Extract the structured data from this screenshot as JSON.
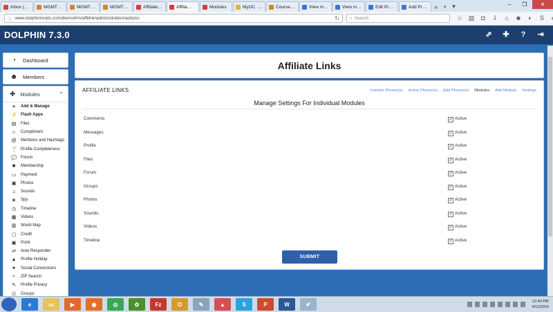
{
  "browser": {
    "tabs": [
      {
        "label": "Inbox (75…",
        "icon_color": "#d44638",
        "active": false
      },
      {
        "label": "MGMT20…",
        "icon_color": "#c98a2a",
        "active": false
      },
      {
        "label": "MGMT20…",
        "icon_color": "#c98a2a",
        "active": false
      },
      {
        "label": "MGMT20…",
        "icon_color": "#c98a2a",
        "active": false
      },
      {
        "label": "Affiliate L…",
        "icon_color": "#d43c3c",
        "active": false
      },
      {
        "label": "Affilia…",
        "icon_color": "#d43c3c",
        "active": true
      },
      {
        "label": "Modules",
        "icon_color": "#d43c3c",
        "active": false
      },
      {
        "label": "MyOC · D…",
        "icon_color": "#e2b33b",
        "active": false
      },
      {
        "label": "Course …",
        "icon_color": "#c98a2a",
        "active": false
      },
      {
        "label": "View mes…",
        "icon_color": "#3a79c9",
        "active": false
      },
      {
        "label": "View mes…",
        "icon_color": "#3a79c9",
        "active": false
      },
      {
        "label": "Edit Prod…",
        "icon_color": "#3a79c9",
        "active": false
      },
      {
        "label": "Add Prod…",
        "icon_color": "#3a79c9",
        "active": false
      }
    ],
    "url": "www.dolphinmods.com/demo4/m/affilink/administration/actions",
    "search_placeholder": "Search"
  },
  "app": {
    "logo": "DOLPHIN 7.3.0"
  },
  "sidebar": {
    "dashboard": "Dashboard",
    "members": "Members",
    "modules": "Modules",
    "items": [
      {
        "label": "Add & Manage",
        "icon": "+",
        "bold": true
      },
      {
        "label": "Flash Apps",
        "icon": "⚡",
        "bold": true
      },
      {
        "label": "Files",
        "icon": "▤",
        "bold": false
      },
      {
        "label": "Compliment",
        "icon": "☺",
        "bold": false
      },
      {
        "label": "Mentions and Hashtags",
        "icon": "@",
        "bold": false
      },
      {
        "label": "Profile Completeness",
        "icon": "🍸",
        "bold": false
      },
      {
        "label": "Forum",
        "icon": "💬",
        "bold": false
      },
      {
        "label": "Membership",
        "icon": "✹",
        "bold": false
      },
      {
        "label": "Payment",
        "icon": "▭",
        "bold": false
      },
      {
        "label": "Photos",
        "icon": "▣",
        "bold": false
      },
      {
        "label": "Sounds",
        "icon": "♫",
        "bold": false
      },
      {
        "label": "Spy",
        "icon": "◈",
        "bold": false
      },
      {
        "label": "Timeline",
        "icon": "◷",
        "bold": false
      },
      {
        "label": "Videos",
        "icon": "▦",
        "bold": false
      },
      {
        "label": "World Map",
        "icon": "▥",
        "bold": false
      },
      {
        "label": "Credit",
        "icon": "▢",
        "bold": false
      },
      {
        "label": "Point",
        "icon": "▣",
        "bold": false
      },
      {
        "label": "Auto Responder",
        "icon": "⇄",
        "bold": false
      },
      {
        "label": "Profile Holiday",
        "icon": "▲",
        "bold": false
      },
      {
        "label": "Social Connections",
        "icon": "●",
        "bold": false
      },
      {
        "label": "ZIP Search",
        "icon": "⌕",
        "bold": false
      },
      {
        "label": "Profile Privacy",
        "icon": "✎",
        "bold": false
      },
      {
        "label": "Groups",
        "icon": "☷",
        "bold": false
      }
    ]
  },
  "main": {
    "page_title": "Affiliate Links",
    "panel_title": "AFFILIATE LINKS",
    "menu": [
      {
        "label": "Inactive Phrase(s)",
        "current": false
      },
      {
        "label": "Active Phrase(s)",
        "current": false
      },
      {
        "label": "Add Phrase(s)",
        "current": false
      },
      {
        "label": "Modules",
        "current": true
      },
      {
        "label": "Add Module",
        "current": false
      },
      {
        "label": "Settings",
        "current": false
      }
    ],
    "subheading": "Manage Settings For Individual Modules",
    "modules": [
      {
        "name": "Comments",
        "status": "Active",
        "checked": true
      },
      {
        "name": "Messages",
        "status": "Active",
        "checked": true
      },
      {
        "name": "Profile",
        "status": "Active",
        "checked": true
      },
      {
        "name": "Files",
        "status": "Active",
        "checked": true
      },
      {
        "name": "Forum",
        "status": "Active",
        "checked": true
      },
      {
        "name": "Groups",
        "status": "Active",
        "checked": true
      },
      {
        "name": "Photos",
        "status": "Active",
        "checked": true
      },
      {
        "name": "Sounds",
        "status": "Active",
        "checked": true
      },
      {
        "name": "Videos",
        "status": "Active",
        "checked": true
      },
      {
        "name": "Timeline",
        "status": "Active",
        "checked": true
      }
    ],
    "submit_label": "SUBMIT"
  },
  "taskbar": {
    "apps": [
      {
        "name": "ie",
        "color": "#2b7ad1",
        "glyph": "e"
      },
      {
        "name": "explorer",
        "color": "#e7c35a",
        "glyph": "▭"
      },
      {
        "name": "media-player",
        "color": "#e26a2c",
        "glyph": "▶"
      },
      {
        "name": "firefox",
        "color": "#e0702a",
        "glyph": "◉"
      },
      {
        "name": "chrome",
        "color": "#3aa757",
        "glyph": "◎"
      },
      {
        "name": "frog",
        "color": "#4d8f2a",
        "glyph": "✿"
      },
      {
        "name": "filezilla",
        "color": "#c23b2b",
        "glyph": "Fz"
      },
      {
        "name": "outlook",
        "color": "#d99a2b",
        "glyph": "O"
      },
      {
        "name": "paint",
        "color": "#8da3bb",
        "glyph": "✎"
      },
      {
        "name": "drive",
        "color": "#d45151",
        "glyph": "▲"
      },
      {
        "name": "skype",
        "color": "#2aa4e0",
        "glyph": "S"
      },
      {
        "name": "powerpoint",
        "color": "#d04b2b",
        "glyph": "P"
      },
      {
        "name": "word",
        "color": "#2b5797",
        "glyph": "W"
      },
      {
        "name": "notepad",
        "color": "#9bb3cc",
        "glyph": "✐"
      }
    ],
    "time": "12:49 PM",
    "date": "4/12/2016"
  }
}
